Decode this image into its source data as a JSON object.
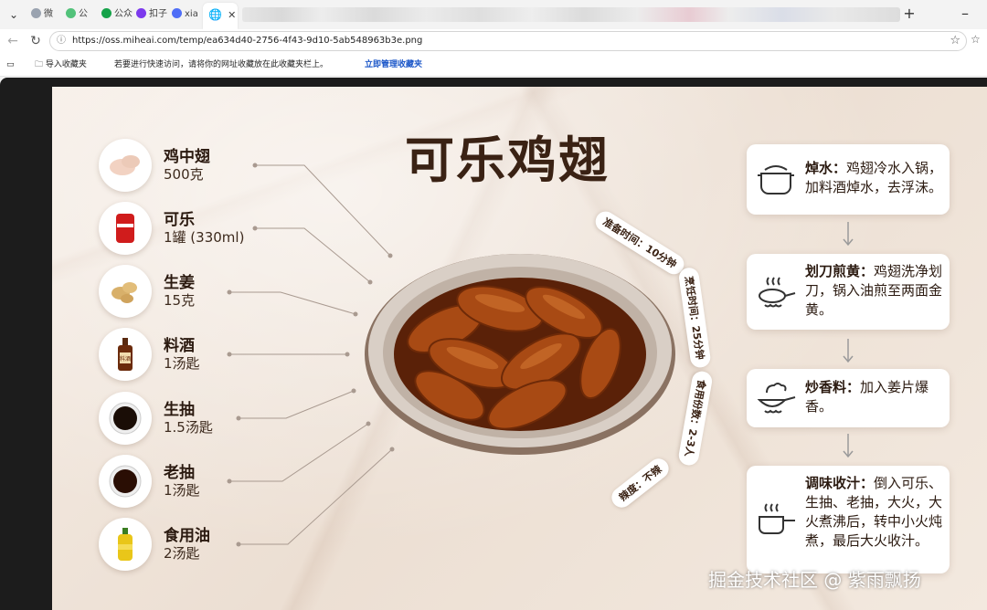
{
  "browser": {
    "tabs": [
      {
        "label": "微"
      },
      {
        "label": "公"
      },
      {
        "label": "公众"
      },
      {
        "label": "扣子"
      },
      {
        "label": "xia"
      }
    ],
    "active_tab": {
      "label": ""
    },
    "url": "https://oss.miheai.com/temp/ea634d40-2756-4f43-9d10-5ab548963b3e.png",
    "bookmarks": {
      "import_label": "导入收藏夹",
      "hint": "若要进行快速访问，请将你的网址收藏放在此收藏夹栏上。",
      "manage_link": "立即管理收藏夹"
    }
  },
  "poster": {
    "title": "可乐鸡翅",
    "ingredients": [
      {
        "name": "鸡中翅",
        "amount": "500克",
        "icon": "chicken-wing-icon"
      },
      {
        "name": "可乐",
        "amount": "1罐 (330ml)",
        "icon": "cola-can-icon"
      },
      {
        "name": "生姜",
        "amount": "15克",
        "icon": "ginger-icon"
      },
      {
        "name": "料酒",
        "amount": "1汤匙",
        "icon": "cooking-wine-bottle-icon"
      },
      {
        "name": "生抽",
        "amount": "1.5汤匙",
        "icon": "light-soy-sauce-icon"
      },
      {
        "name": "老抽",
        "amount": "1汤匙",
        "icon": "dark-soy-sauce-icon"
      },
      {
        "name": "食用油",
        "amount": "2汤匙",
        "icon": "oil-bottle-icon"
      }
    ],
    "bottle_label": "料酒",
    "info": {
      "prep_time": "准备时间：10分钟",
      "cook_time": "烹饪时间：25分钟",
      "servings": "食用份数：2-3人",
      "spice": "辣度：不辣"
    },
    "steps": [
      {
        "title": "焯水：",
        "text": "鸡翅冷水入锅，加料酒焯水，去浮沫。",
        "icon": "pot-icon"
      },
      {
        "title": "划刀煎黄：",
        "text": "鸡翅洗净划刀，锅入油煎至两面金黄。",
        "icon": "frying-pan-icon"
      },
      {
        "title": "炒香料：",
        "text": "加入姜片爆香。",
        "icon": "wok-icon"
      },
      {
        "title": "调味收汁：",
        "text": "倒入可乐、生抽、老抽，大火，大火煮沸后，转中小火炖煮，最后大火收汁。",
        "icon": "saucepan-icon"
      }
    ],
    "colors": {
      "title": "#3a2214",
      "sauce": "#a84a14",
      "plate_rim": "#9c8575"
    }
  },
  "watermark": "掘金技术社区 @ 紫雨飘扬"
}
